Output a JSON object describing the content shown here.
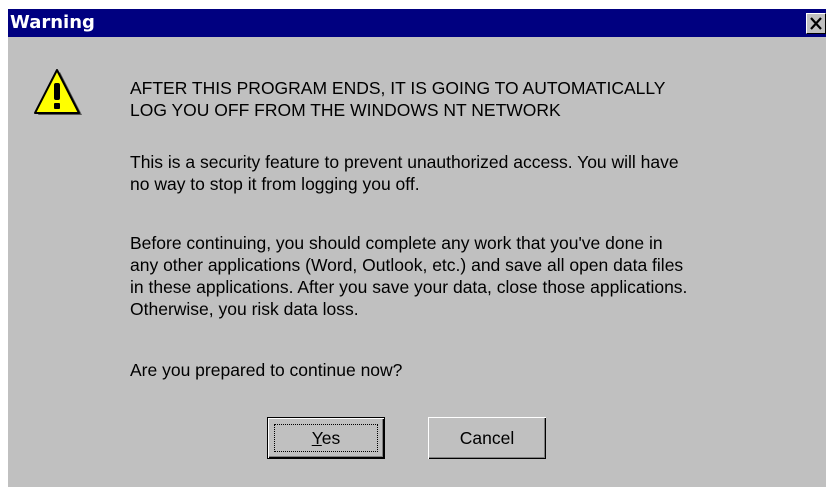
{
  "dialog": {
    "title": "Warning",
    "close_glyph": "✕",
    "icon": "warning-triangle-icon",
    "heading_line1": "AFTER THIS PROGRAM ENDS, IT IS GOING TO AUTOMATICALLY",
    "heading_line2": "LOG YOU OFF FROM THE WINDOWS NT NETWORK",
    "para1_line1": "This is a security feature to prevent unauthorized access. You will have",
    "para1_line2": "no way to stop it from logging you off.",
    "para2_line1": "Before continuing, you should complete any work that you've done in",
    "para2_line2": "any other applications (Word, Outlook, etc.) and save all open data files",
    "para2_line3": "in these applications. After you save your data, close those applications.",
    "para2_line4": "Otherwise, you risk data loss.",
    "question": "Are you prepared to continue now?",
    "yes_label": "Yes",
    "cancel_label": "Cancel"
  },
  "colors": {
    "titlebar": "#000080",
    "face": "#c0c0c0",
    "icon_fill": "#ffff00"
  }
}
